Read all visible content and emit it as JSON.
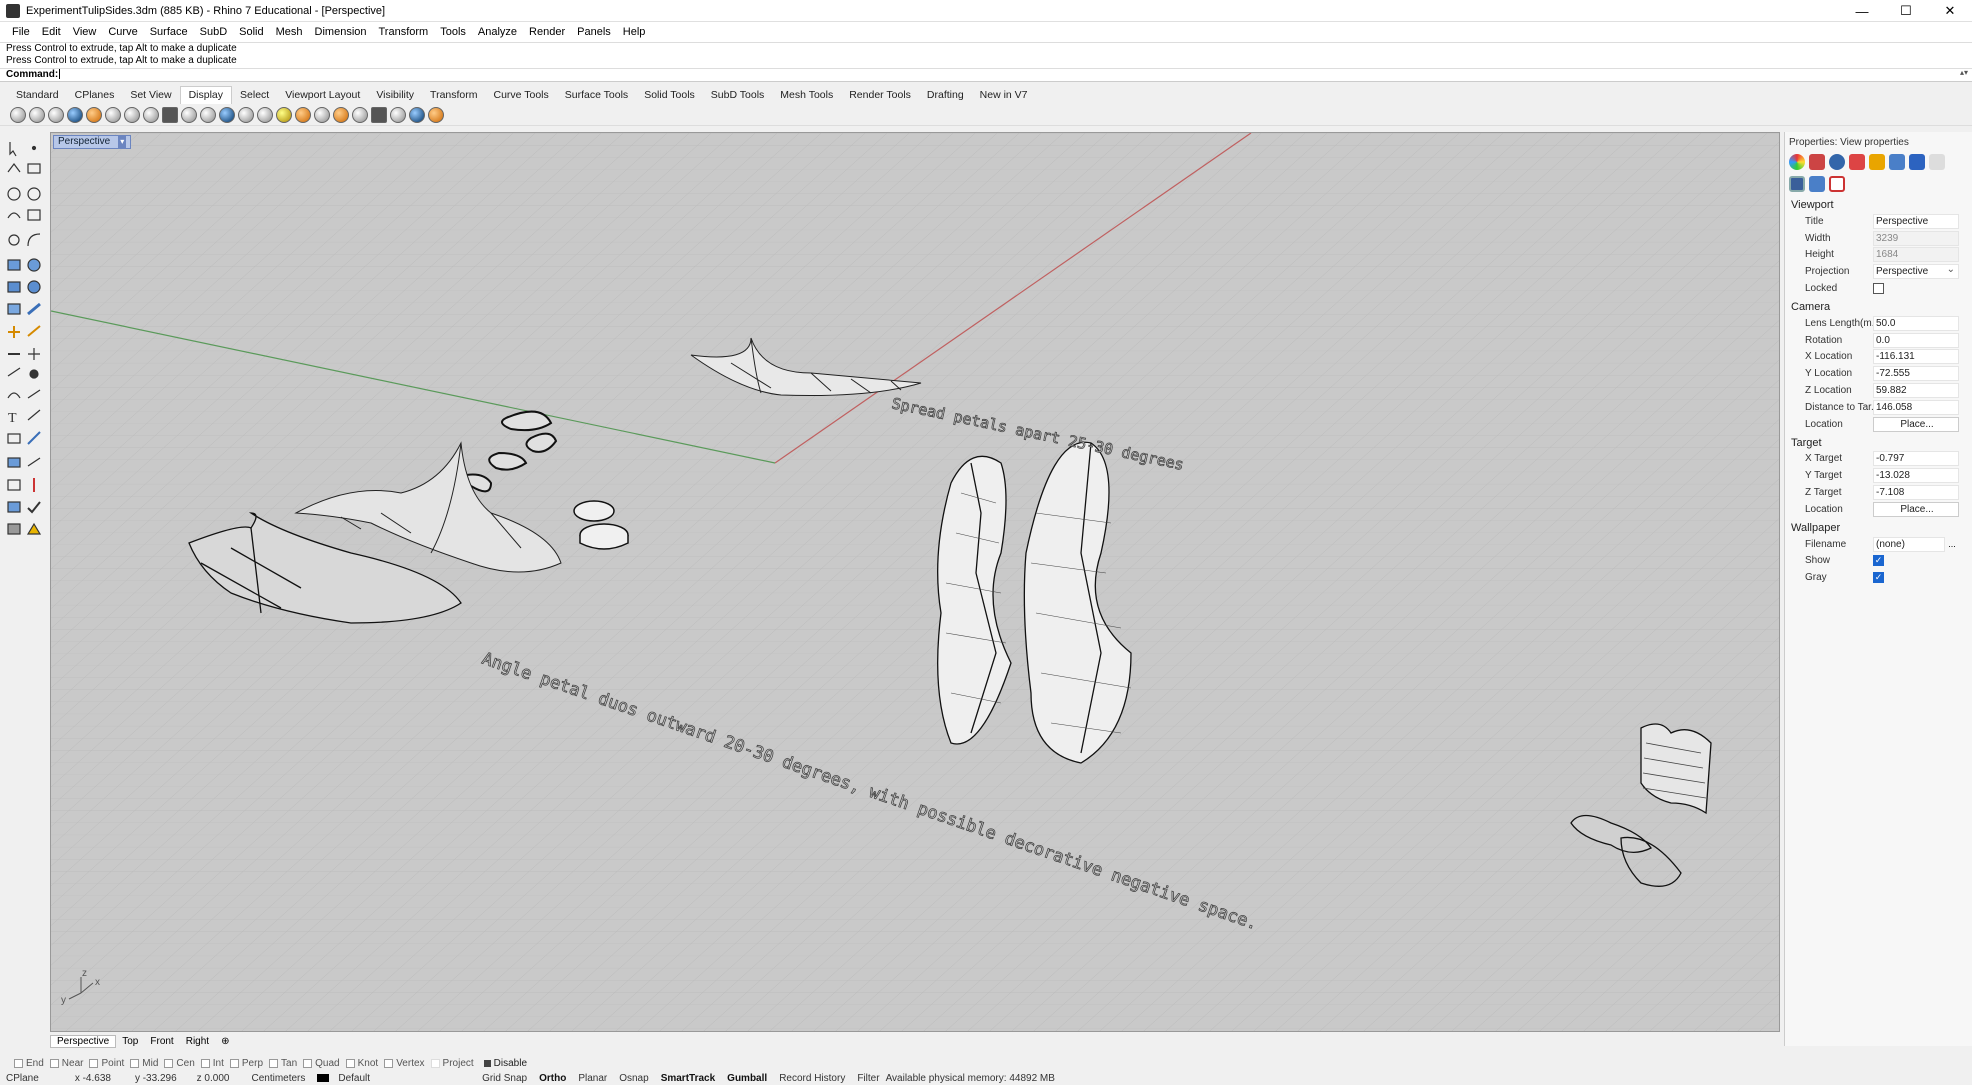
{
  "window": {
    "title": "ExperimentTulipSides.3dm (885 KB) - Rhino 7 Educational - [Perspective]",
    "controls": [
      "—",
      "☐",
      "✕"
    ]
  },
  "menu": [
    "File",
    "Edit",
    "View",
    "Curve",
    "Surface",
    "SubD",
    "Solid",
    "Mesh",
    "Dimension",
    "Transform",
    "Tools",
    "Analyze",
    "Render",
    "Panels",
    "Help"
  ],
  "command": {
    "history": [
      "Press Control to extrude, tap Alt to make a duplicate",
      "Press Control to extrude, tap Alt to make a duplicate"
    ],
    "prompt": "Command:"
  },
  "toolbar_tabs": [
    "Standard",
    "CPlanes",
    "Set View",
    "Display",
    "Select",
    "Viewport Layout",
    "Visibility",
    "Transform",
    "Curve Tools",
    "Surface Tools",
    "Solid Tools",
    "SubD Tools",
    "Mesh Tools",
    "Render Tools",
    "Drafting",
    "New in V7"
  ],
  "active_toolbar_tab": "Display",
  "viewport": {
    "name": "Perspective",
    "annotations": [
      "Spread petals apart 25-30 degrees",
      "Angle petal duos outward 20-30 degrees, with possible decorative negative space."
    ],
    "axis": {
      "x": "x",
      "y": "y",
      "z": "z"
    }
  },
  "view_tabs": [
    "Perspective",
    "Top",
    "Front",
    "Right",
    "⊕"
  ],
  "properties": {
    "header": "Properties: View properties",
    "sections": {
      "viewport": {
        "label": "Viewport",
        "title_label": "Title",
        "title": "Perspective",
        "width_label": "Width",
        "width": "3239",
        "height_label": "Height",
        "height": "1684",
        "projection_label": "Projection",
        "projection": "Perspective",
        "locked_label": "Locked"
      },
      "camera": {
        "label": "Camera",
        "lens_label": "Lens Length(m...",
        "lens": "50.0",
        "rotation_label": "Rotation",
        "rotation": "0.0",
        "xloc_label": "X Location",
        "xloc": "-116.131",
        "yloc_label": "Y Location",
        "yloc": "-72.555",
        "zloc_label": "Z Location",
        "zloc": "59.882",
        "dist_label": "Distance to Tar...",
        "dist": "146.058",
        "loc_label": "Location",
        "loc_button": "Place..."
      },
      "target": {
        "label": "Target",
        "x_label": "X Target",
        "x": "-0.797",
        "y_label": "Y Target",
        "y": "-13.028",
        "z_label": "Z Target",
        "z": "-7.108",
        "loc_label": "Location",
        "loc_button": "Place..."
      },
      "wallpaper": {
        "label": "Wallpaper",
        "filename_label": "Filename",
        "filename": "(none)",
        "browse": "...",
        "show_label": "Show",
        "gray_label": "Gray"
      }
    }
  },
  "osnaps": [
    "End",
    "Near",
    "Point",
    "Mid",
    "Cen",
    "Int",
    "Perp",
    "Tan",
    "Quad",
    "Knot",
    "Vertex",
    "Project"
  ],
  "osnap_disable": "Disable",
  "status": {
    "cplane": "CPlane",
    "x": "x -4.638",
    "y": "y -33.296",
    "z": "z 0.000",
    "units": "Centimeters",
    "layer": "Default",
    "grid_snap": "Grid Snap",
    "ortho": "Ortho",
    "planar": "Planar",
    "osnap": "Osnap",
    "smarttrack": "SmartTrack",
    "gumball": "Gumball",
    "record_history": "Record History",
    "filter": "Filter",
    "memory": "Available physical memory: 44892 MB"
  }
}
